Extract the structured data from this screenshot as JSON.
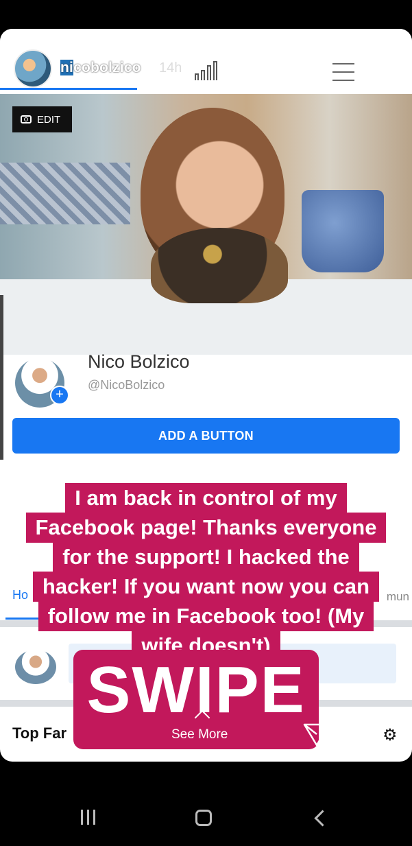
{
  "story": {
    "username": "nicobolzico",
    "username_cursor_part": "ni",
    "username_rest": "cobolzico",
    "time": "14h",
    "progress_segments": 8
  },
  "cover": {
    "edit_label": "EDIT"
  },
  "page": {
    "name": "Nico Bolzico",
    "handle": "@NicoBolzico",
    "add_button_label": "ADD A BUTTON",
    "tab_home_partial": "Ho",
    "tab_community_partial": "mun",
    "top_fans_partial": "Top Far"
  },
  "caption": {
    "lines": [
      "I am back in control of my",
      "Facebook page! Thanks everyone",
      "for the support! I hacked the",
      "hacker! If you want now you can",
      "follow me in Facebook too! (My",
      "wife doesn't)"
    ],
    "swipe": "SWIPE",
    "see_more": "See More"
  },
  "colors": {
    "facebook_blue": "#1877f2",
    "caption_bg": "#c2185b"
  }
}
